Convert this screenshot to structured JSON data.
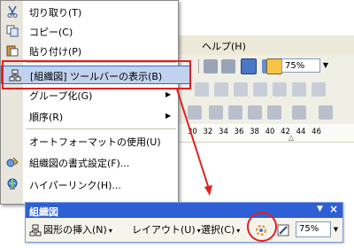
{
  "app": {
    "menubar": {
      "help_label": "ヘルプ(H)"
    },
    "zoom": "75%",
    "ruler": {
      "numbers": "30 32 34 36 38 40 42 44 46",
      "marker": "△"
    }
  },
  "context_menu": {
    "items": [
      {
        "label": "切り取り(T)",
        "icon": "scissors-icon"
      },
      {
        "label": "コピー(C)",
        "icon": "copy-icon"
      },
      {
        "label": "貼り付け(P)",
        "icon": "paste-icon"
      },
      {
        "label": "[組織図] ツールバーの表示(B)",
        "icon": "org-chart-icon",
        "highlighted": true
      },
      {
        "label": "グループ化(G)",
        "icon": "",
        "submenu": true
      },
      {
        "label": "順序(R)",
        "icon": "",
        "submenu": true
      },
      {
        "label": "オートフォーマットの使用(U)",
        "icon": ""
      },
      {
        "label": "組織図の書式設定(F)...",
        "icon": "format-icon"
      },
      {
        "label": "ハイパーリンク(H)...",
        "icon": "hyperlink-icon"
      }
    ],
    "submenu_arrow": "▶"
  },
  "org_toolbar": {
    "title": "組織図",
    "title_dropdown": "▼",
    "close": "×",
    "insert_shape_label": "図形の挿入(N)",
    "layout_label": "レイアウト(U)",
    "select_label": "選択(C)",
    "dropdown_arrow": "▾",
    "zoom": "75%"
  },
  "colors": {
    "annotation_red": "#e02020",
    "titlebar_blue": "#2e5fd6",
    "highlight": "#c1d2ee"
  }
}
